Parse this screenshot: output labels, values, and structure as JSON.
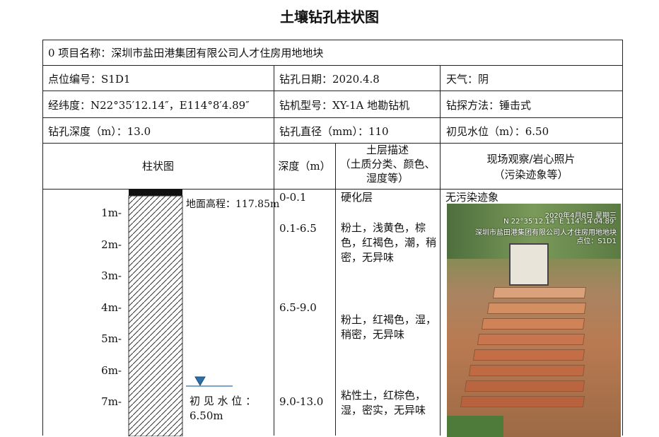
{
  "title": "土壤钻孔柱状图",
  "project": "0 项目名称：深圳市盐田港集团有限公司人才住房用地地块",
  "info": {
    "point": "点位编号：S1D1",
    "date": "钻孔日期：2020.4.8",
    "weather": "天气：阴",
    "coords": "经纬度：N22°35′12.14″，E114°8′4.89″",
    "rig": "钻机型号：XY-1A 地勘钻机",
    "method": "钻探方法：锤击式",
    "depth": "钻孔深度（m）：13.0",
    "diameter": "钻孔直径（mm）：110",
    "water": "初见水位（m）：6.50"
  },
  "headers": {
    "column": "柱状图",
    "depth": "深度（m）",
    "desc_1": "土层描述",
    "desc_2": "（土质分类、颜色、",
    "desc_3": "湿度等）",
    "photo_1": "现场观察/岩心照片",
    "photo_2": "（污染迹象等）"
  },
  "column": {
    "ground_elevation": "地面高程：117.85m",
    "water_label_1": "初 见 水 位 ：",
    "water_label_2": "6.50m",
    "ticks": [
      "1m-",
      "2m-",
      "3m-",
      "4m-",
      "5m-",
      "6m-",
      "7m-"
    ]
  },
  "layers": [
    {
      "depth": "0-0.1",
      "desc": "硬化层"
    },
    {
      "depth": "0.1-6.5",
      "desc": "粉土，浅黄色，棕色，红褐色，潮，稍密，无异味"
    },
    {
      "depth": "6.5-9.0",
      "desc": "粉土，红褐色，湿，稍密，无异味"
    },
    {
      "depth": "9.0-13.0",
      "desc": "粘性土，红棕色，湿，密实，无异味"
    }
  ],
  "observation": "无污染迹象",
  "photo_stamp": {
    "line1": "2020年4月8日 星期三",
    "line2": "N 22°35′12.14″ E 114°14′04.89″",
    "line3": "深圳市盐田港集团有限公司人才住房用地地块",
    "line4": "点位：S1D1"
  },
  "colors": {
    "line": "#222222",
    "water": "#2a6fa8"
  }
}
